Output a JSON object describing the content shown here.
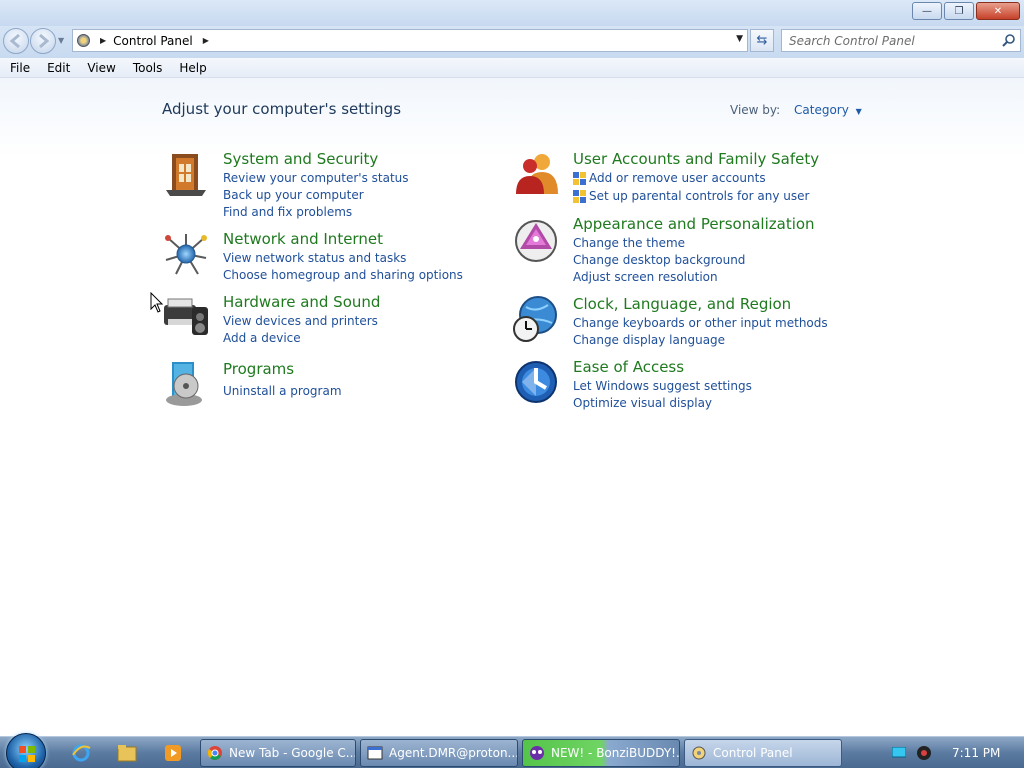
{
  "window": {
    "minimize_icon": "minimize-icon",
    "maximize_icon": "restore-icon",
    "close_icon": "close-icon"
  },
  "address": {
    "crumb": "Control Panel",
    "search_placeholder": "Search Control Panel"
  },
  "menu": [
    "File",
    "Edit",
    "View",
    "Tools",
    "Help"
  ],
  "main": {
    "title": "Adjust your computer's settings",
    "view_by_label": "View by:",
    "view_by_value": "Category"
  },
  "categories": {
    "system": {
      "title": "System and Security",
      "links": [
        "Review your computer's status",
        "Back up your computer",
        "Find and fix problems"
      ]
    },
    "network": {
      "title": "Network and Internet",
      "links": [
        "View network status and tasks",
        "Choose homegroup and sharing options"
      ]
    },
    "hardware": {
      "title": "Hardware and Sound",
      "links": [
        "View devices and printers",
        "Add a device"
      ]
    },
    "programs": {
      "title": "Programs",
      "links": [
        "Uninstall a program"
      ]
    },
    "users": {
      "title": "User Accounts and Family Safety",
      "links": [
        "Add or remove user accounts",
        "Set up parental controls for any user"
      ]
    },
    "appearance": {
      "title": "Appearance and Personalization",
      "links": [
        "Change the theme",
        "Change desktop background",
        "Adjust screen resolution"
      ]
    },
    "clock": {
      "title": "Clock, Language, and Region",
      "links": [
        "Change keyboards or other input methods",
        "Change display language"
      ]
    },
    "ease": {
      "title": "Ease of Access",
      "links": [
        "Let Windows suggest settings",
        "Optimize visual display"
      ]
    }
  },
  "taskbar": {
    "tasks": [
      "New Tab - Google C...",
      "Agent.DMR@proton...",
      "NEW! - BonziBUDDY!...",
      "Control Panel"
    ],
    "clock": "7:11 PM"
  },
  "colors": {
    "category_title": "#1f7a1f",
    "link": "#1f4f99",
    "heading": "#1e395b"
  }
}
